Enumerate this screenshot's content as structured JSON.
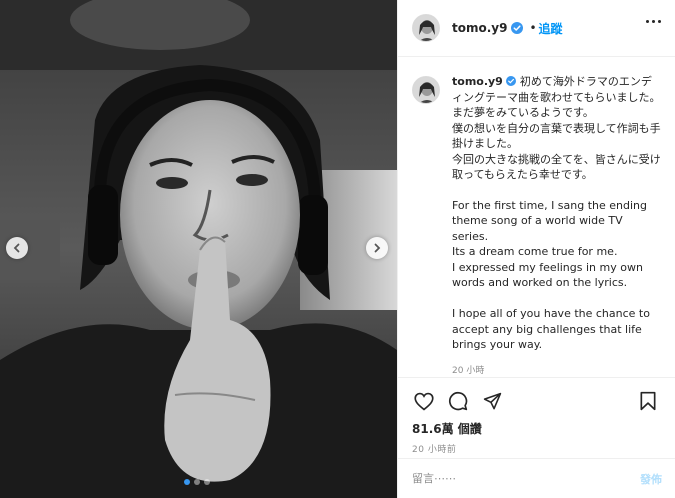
{
  "post": {
    "username": "tomo.y9",
    "verified": true,
    "follow_label": "追蹤",
    "separator": "•",
    "more_icon": "more-horizontal-icon"
  },
  "caption": {
    "username": "tomo.y9",
    "japanese": "初めて海外ドラマのエンディングテーマ曲を歌わせてもらいました。\nまだ夢をみているようです。\n僕の想いを自分の言葉で表現して作詞も手掛けました。\n今回の大きな挑戦の全てを、皆さんに受け取ってもらえたら幸せです。",
    "english": "For the first time, I sang the ending theme song of a world wide TV series.\nIts a dream come true for me.\nI expressed my feelings in my own words and worked on the lyrics.\n\nI hope all of you have the chance to accept any big challenges that life brings your way.",
    "time": "20 小時"
  },
  "stats": {
    "views": "81.6萬 個讚",
    "posted": "20 小時前"
  },
  "comment": {
    "placeholder": "留言⋯⋯",
    "post_label": "發佈"
  },
  "carousel": {
    "total": 3,
    "active": 1
  },
  "colors": {
    "accent": "#0095f6",
    "verified": "#3897f0",
    "post_disabled": "#b2dffc"
  }
}
